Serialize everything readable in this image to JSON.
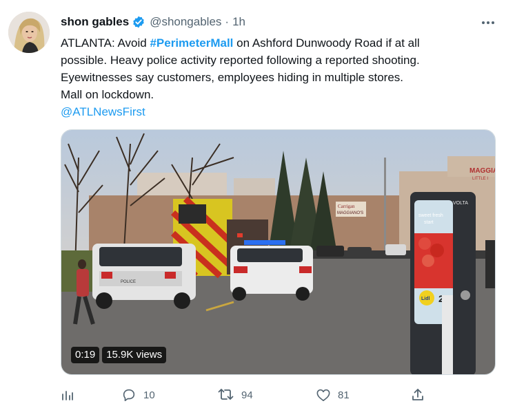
{
  "author": {
    "name": "shon gables",
    "handle": "@shongables",
    "separator": "·",
    "time": "1h"
  },
  "tweet": {
    "line1_prefix": "ATLANTA: Avoid ",
    "hashtag": "#PerimeterMall",
    "line1_suffix": " on Ashford Dunwoody Road if at all",
    "line2": "possible. Heavy police activity reported following a reported shooting.",
    "line3": "Eyewitnesses say customers, employees hiding in multiple stores.",
    "line4": "Mall on lockdown.",
    "mention": "@ATLNewsFirst"
  },
  "media": {
    "duration": "0:19",
    "views": "15.9K views",
    "store_sign_1": "MAGGIA",
    "store_sign_2": "LITTLE I",
    "restaurant_sign_1": "Carrigan",
    "restaurant_sign_2": "MAGGIANO'S",
    "kiosk_brand": "VOLTA",
    "kiosk_text_1": "sweet fresh",
    "kiosk_text_2": "start",
    "kiosk_logo": "Lidl",
    "kiosk_price": "2",
    "police_text": "POLICE"
  },
  "actions": {
    "replies": "10",
    "retweets": "94",
    "likes": "81"
  },
  "icons": {
    "analytics": "bar-chart-icon",
    "reply": "speech-bubble-icon",
    "retweet": "retweet-arrows-icon",
    "like": "heart-icon",
    "share": "share-upload-icon",
    "more": "ellipsis-icon",
    "verified": "verified-badge-icon"
  },
  "colors": {
    "accent": "#1d9bf0",
    "text": "#0f1419",
    "muted": "#536471"
  }
}
